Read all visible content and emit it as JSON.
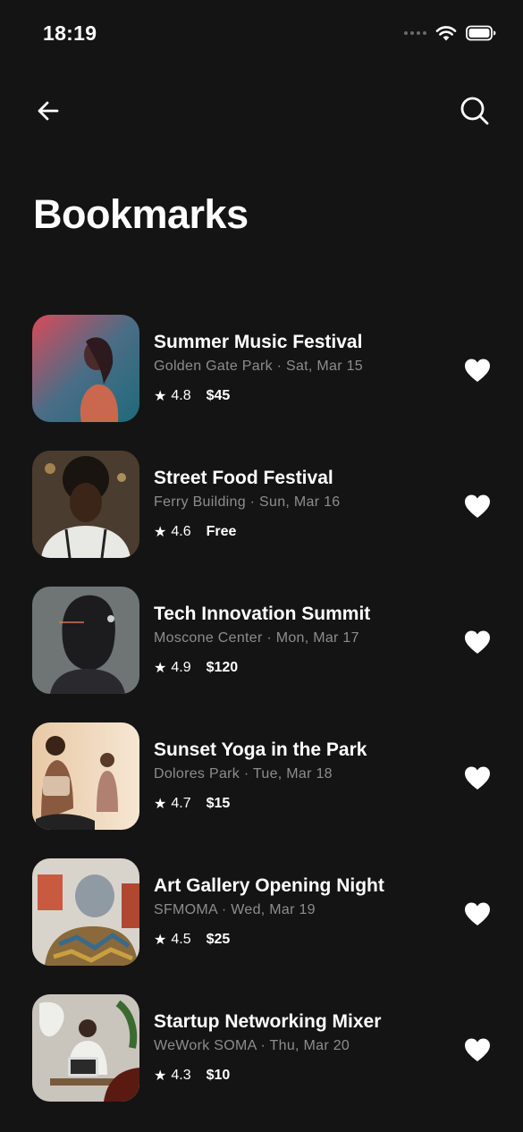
{
  "status": {
    "time": "18:19"
  },
  "header": {
    "title": "Bookmarks",
    "back_icon": "arrow-left-icon",
    "search_icon": "search-icon"
  },
  "colors": {
    "background": "#141414",
    "text": "#ffffff",
    "subtext": "#8d8d8d"
  },
  "items": [
    {
      "title": "Summer Music Festival",
      "subtitle": "Golden Gate Park · Sat, Mar 15",
      "rating": "4.8",
      "price": "$45",
      "bookmarked": true
    },
    {
      "title": "Street Food Festival",
      "subtitle": "Ferry Building · Sun, Mar 16",
      "rating": "4.6",
      "price": "Free",
      "bookmarked": true
    },
    {
      "title": "Tech Innovation Summit",
      "subtitle": "Moscone Center · Mon, Mar 17",
      "rating": "4.9",
      "price": "$120",
      "bookmarked": true
    },
    {
      "title": "Sunset Yoga in the Park",
      "subtitle": "Dolores Park · Tue, Mar 18",
      "rating": "4.7",
      "price": "$15",
      "bookmarked": true
    },
    {
      "title": "Art Gallery Opening Night",
      "subtitle": "SFMOMA · Wed, Mar 19",
      "rating": "4.5",
      "price": "$25",
      "bookmarked": true
    },
    {
      "title": "Startup Networking Mixer",
      "subtitle": "WeWork SOMA · Thu, Mar 20",
      "rating": "4.3",
      "price": "$10",
      "bookmarked": true
    }
  ]
}
